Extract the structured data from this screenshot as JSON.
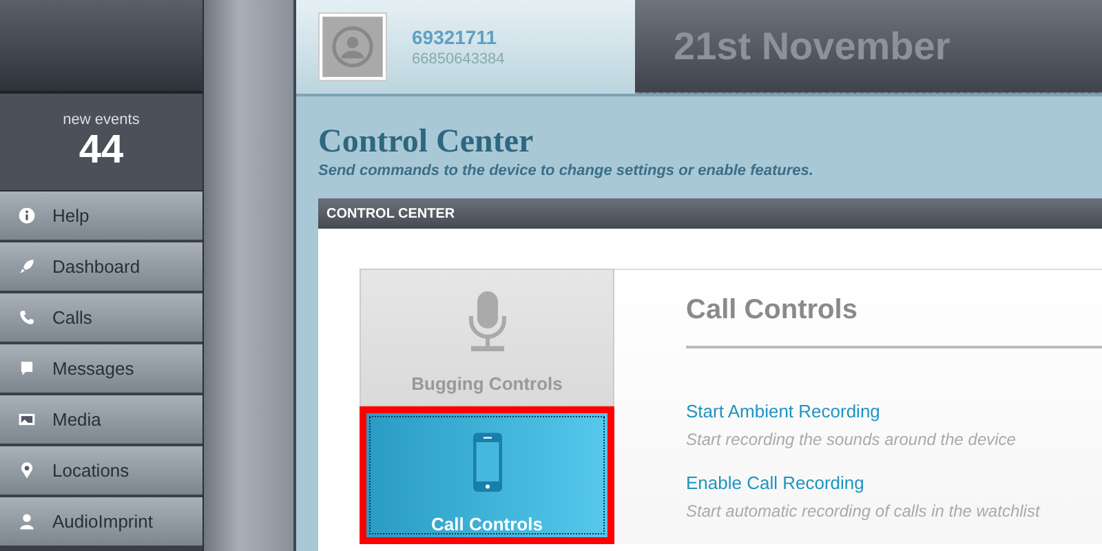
{
  "sidebar": {
    "events_label": "new events",
    "events_count": "44",
    "items": [
      {
        "label": "Help",
        "selected": false
      },
      {
        "label": "Dashboard",
        "selected": false
      },
      {
        "label": "Calls",
        "selected": false
      },
      {
        "label": "Messages",
        "selected": false
      },
      {
        "label": "Media",
        "selected": false
      },
      {
        "label": "Locations",
        "selected": false
      },
      {
        "label": "AudioImprint",
        "selected": false
      }
    ]
  },
  "header": {
    "user_name": "69321711",
    "user_number": "66850643384",
    "date": "21st November"
  },
  "page": {
    "title": "Control Center",
    "subtitle": "Send commands to the device to change settings or enable features."
  },
  "panel": {
    "title": "CONTROL CENTER",
    "tiles": [
      {
        "label": "Bugging Controls",
        "kind": "mic",
        "selected": false
      },
      {
        "label": "Call Controls",
        "kind": "phone",
        "selected": true
      }
    ],
    "section_title": "Call Controls",
    "actions": [
      {
        "link": "Start Ambient Recording",
        "description": "Start recording the sounds around the device"
      },
      {
        "link": "Enable Call Recording",
        "description": "Start automatic recording of calls in the watchlist"
      }
    ]
  }
}
